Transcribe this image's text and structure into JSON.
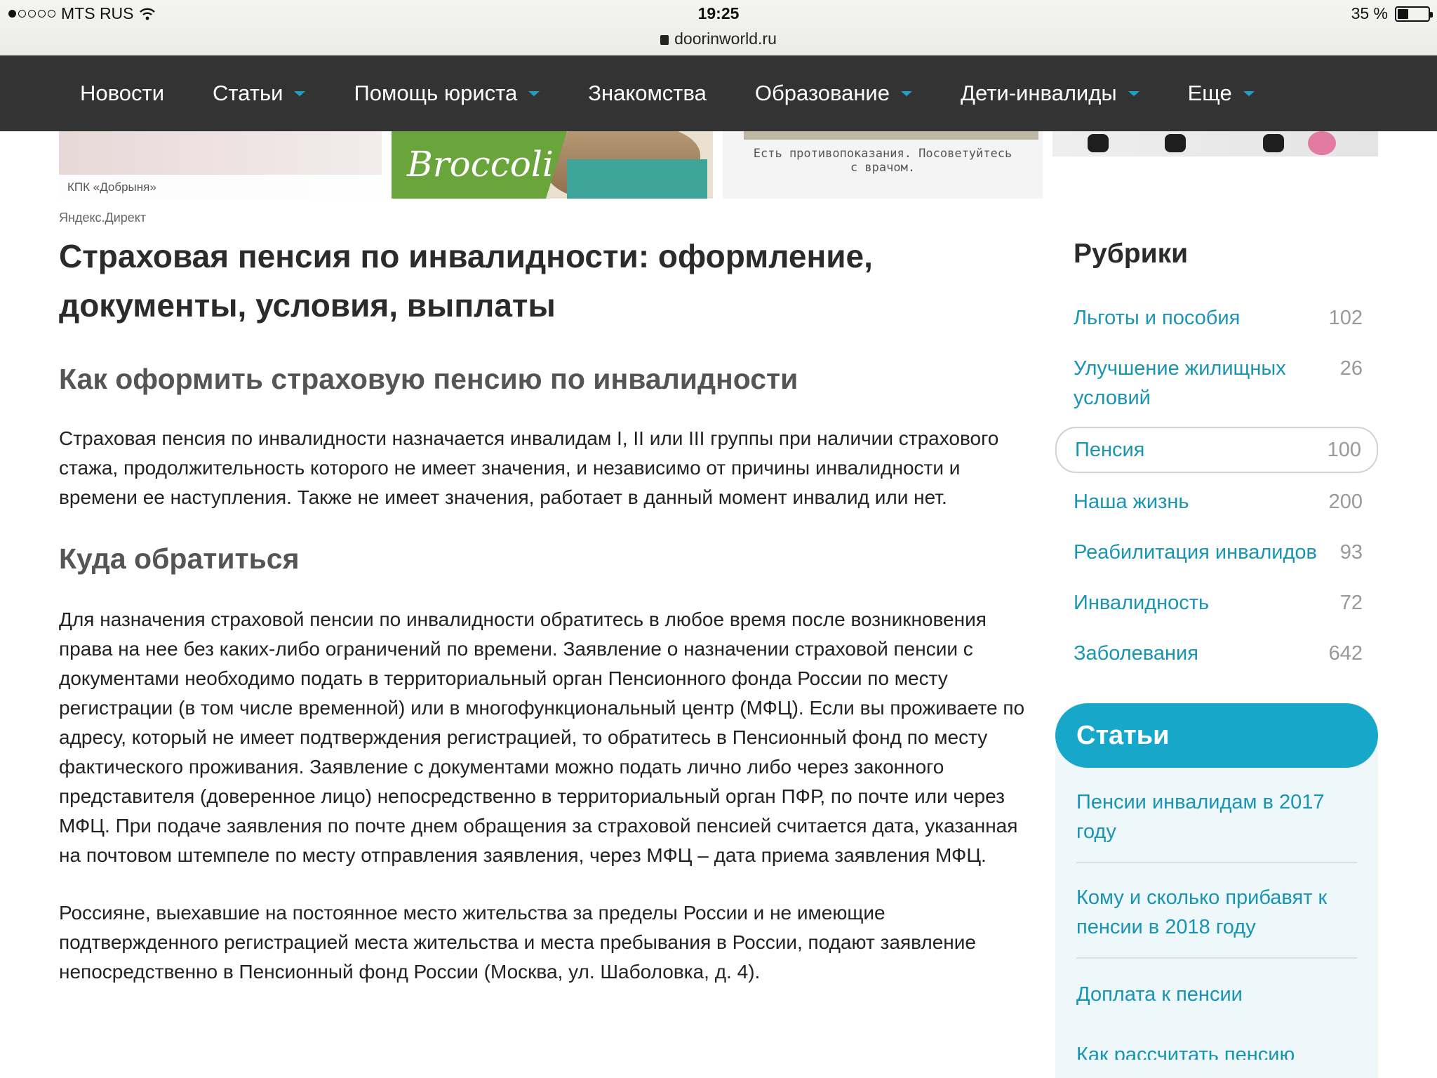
{
  "status_bar": {
    "carrier": "MTS RUS",
    "time": "19:25",
    "battery_text": "35 %",
    "battery_level": 0.35,
    "url": "doorinworld.ru"
  },
  "nav": {
    "items": [
      {
        "label": "Новости"
      },
      {
        "label": "Статьи"
      },
      {
        "label": "Помощь юриста"
      },
      {
        "label": "Знакомства"
      },
      {
        "label": "Образование"
      },
      {
        "label": "Дети-инвалиды"
      },
      {
        "label": "Еще"
      }
    ]
  },
  "ads": {
    "ad1_caption": "КПК «Добрыня»",
    "ad2_brand": "Broccoli",
    "ad3_note": "Есть противопоказания. Посоветуйтесь с врачом.",
    "source": "Яндекс.Директ"
  },
  "article": {
    "title": "Страховая пенсия по инвалидности: оформление, документы, условия, выплаты",
    "h2_1": "Как оформить страховую пенсию по инвалидности",
    "p1": "Страховая пенсия по инвалидности назначается инвалидам I, II или III группы при наличии страхового стажа, продолжительность которого не имеет значения, и независимо от причины инвалидности и времени ее наступления. Также не имеет значения, работает в данный момент инвалид или нет.",
    "h2_2": "Куда обратиться",
    "p2": "Для назначения страховой пенсии по инвалидности обратитесь в любое время после возникновения права на нее без каких-либо ограничений по времени. Заявление о назначении страховой пенсии с документами необходимо подать в территориальный орган Пенсионного фонда России по месту регистрации (в том числе временной) или в многофункциональный центр (МФЦ). Если вы проживаете по адресу, который не имеет подтверждения регистрацией, то обратитесь в Пенсионный фонд по месту фактического проживания. Заявление с документами можно подать лично либо через законного представителя (доверенное лицо) непосредственно в территориальный орган ПФР, по почте или через МФЦ. При подаче заявления по почте днем обращения за страховой пенсией считается дата, указанная на почтовом штемпеле по месту отправления заявления, через МФЦ – дата приема заявления МФЦ.",
    "p3": "Россияне, выехавшие на постоянное место жительства за пределы России и не имеющие подтвержденного регистрацией места жительства и места пребывания в России, подают заявление непосредственно в Пенсионный фонд России (Москва, ул. Шаболовка, д. 4)."
  },
  "sidebar": {
    "rubrics_title": "Рубрики",
    "rubrics": [
      {
        "name": "Льготы и пособия",
        "count": "102"
      },
      {
        "name": "Улучшение жилищных условий",
        "count": "26"
      },
      {
        "name": "Пенсия",
        "count": "100"
      },
      {
        "name": "Наша жизнь",
        "count": "200"
      },
      {
        "name": "Реабилитация инвалидов",
        "count": "93"
      },
      {
        "name": "Инвалидность",
        "count": "72"
      },
      {
        "name": "Заболевания",
        "count": "642"
      }
    ],
    "articles_title": "Статьи",
    "articles": [
      {
        "title": "Пенсии инвалидам в 2017 году"
      },
      {
        "title": "Кому и сколько прибавят к пенсии в 2018 году"
      },
      {
        "title": "Доплата к пенсии"
      },
      {
        "title": "Как рассчитать пенсию"
      }
    ]
  }
}
